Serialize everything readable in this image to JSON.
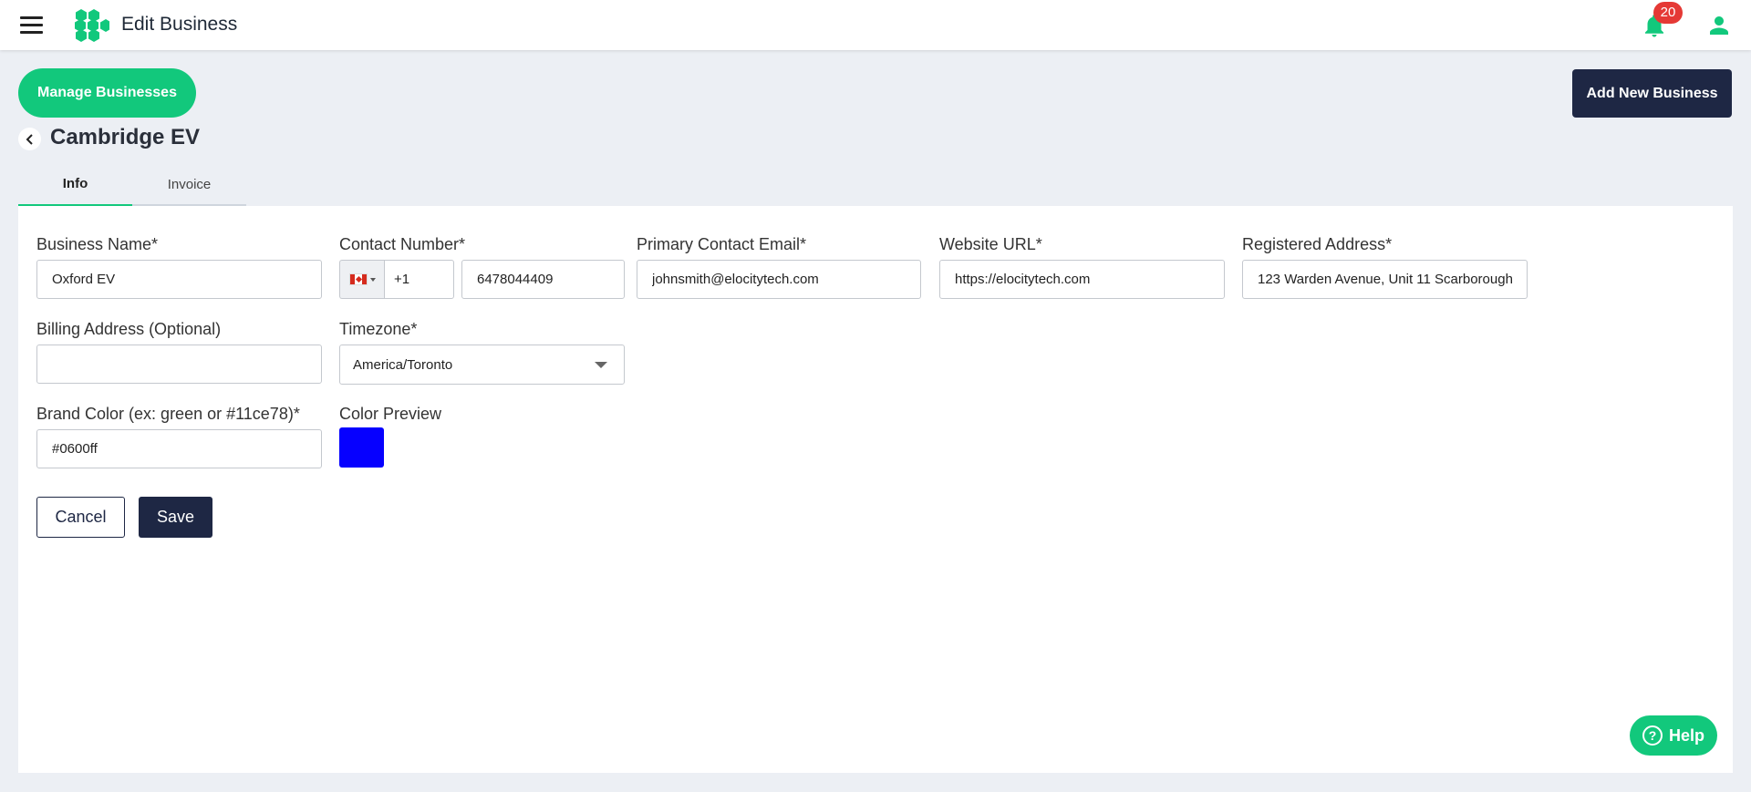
{
  "topbar": {
    "title": "Edit Business",
    "notification_count": "20",
    "icons": {
      "menu": "hamburger-icon",
      "logo": "hexagon-cluster-logo",
      "notifications": "bell-icon",
      "account": "user-icon"
    }
  },
  "actions": {
    "manage_label": "Manage Businesses",
    "add_label": "Add New Business"
  },
  "page": {
    "title": "Cambridge EV",
    "back_icon": "chevron-left-icon"
  },
  "tabs": [
    {
      "label": "Info",
      "active": true
    },
    {
      "label": "Invoice",
      "active": false
    }
  ],
  "form": {
    "business_name": {
      "label": "Business Name*",
      "value": "Oxford EV"
    },
    "contact_number": {
      "label": "Contact Number*",
      "country": "Canada",
      "code": "+1",
      "value": "6478044409"
    },
    "primary_email": {
      "label": "Primary Contact Email*",
      "value": "johnsmith@elocitytech.com"
    },
    "website": {
      "label": "Website URL*",
      "value": "https://elocitytech.com"
    },
    "registered_address": {
      "label": "Registered Address*",
      "value": "123 Warden Avenue, Unit 11 Scarborough"
    },
    "billing_address": {
      "label": "Billing Address (Optional)",
      "value": ""
    },
    "timezone": {
      "label": "Timezone*",
      "value": "America/Toronto"
    },
    "brand_color": {
      "label": "Brand Color (ex: green or #11ce78)*",
      "value": "#0600ff"
    },
    "color_preview": {
      "label": "Color Preview",
      "color": "#0600ff"
    }
  },
  "buttons": {
    "cancel": "Cancel",
    "save": "Save",
    "help": "Help"
  },
  "colors": {
    "accent": "#12c87c",
    "navy": "#1e2744",
    "badge": "#e53935"
  }
}
